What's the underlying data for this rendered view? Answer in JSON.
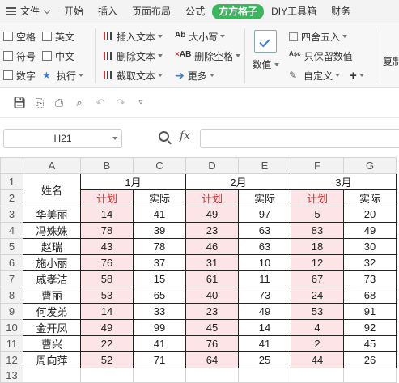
{
  "menu": {
    "file": "文件",
    "tabs": [
      "开始",
      "插入",
      "页面布局",
      "公式",
      "方方格子",
      "DIY工具箱",
      "财务"
    ]
  },
  "ribbon": {
    "checks": [
      "空格",
      "英文",
      "符号",
      "中文",
      "数字"
    ],
    "execute": "执行",
    "text_ops": [
      "插入文本",
      "删除文本",
      "截取文本"
    ],
    "case_ops": [
      "大小写",
      "删除空格",
      "更多"
    ],
    "value_btn": "数值",
    "round_ops": [
      "四舍五入",
      "只保留数值",
      "自定义"
    ],
    "plus": "+",
    "copy_btn": "复制"
  },
  "formula_bar": {
    "cell_ref": "H21",
    "fx": "fx",
    "content": ""
  },
  "sheet": {
    "columns": [
      "A",
      "B",
      "C",
      "D",
      "E",
      "F",
      "G"
    ],
    "rows": [
      "1",
      "2",
      "3",
      "4",
      "5",
      "6",
      "7",
      "8",
      "9",
      "10",
      "11",
      "12",
      "13"
    ],
    "name_header": "姓名",
    "months": [
      "1月",
      "2月",
      "3月"
    ],
    "plan": "计划",
    "actual": "实际",
    "people": [
      {
        "name": "华美丽",
        "v": [
          14,
          41,
          49,
          97,
          5,
          20
        ]
      },
      {
        "name": "冯姝姝",
        "v": [
          78,
          39,
          23,
          63,
          83,
          49
        ]
      },
      {
        "name": "赵瑞",
        "v": [
          43,
          78,
          46,
          63,
          18,
          30
        ]
      },
      {
        "name": "施小丽",
        "v": [
          76,
          37,
          31,
          10,
          12,
          32
        ]
      },
      {
        "name": "戚孝洁",
        "v": [
          58,
          15,
          61,
          11,
          67,
          73
        ]
      },
      {
        "name": "曹丽",
        "v": [
          53,
          65,
          40,
          73,
          24,
          68
        ]
      },
      {
        "name": "何发弟",
        "v": [
          14,
          33,
          23,
          49,
          53,
          91
        ]
      },
      {
        "name": "金开凤",
        "v": [
          49,
          99,
          45,
          14,
          4,
          92
        ]
      },
      {
        "name": "曹兴",
        "v": [
          22,
          41,
          76,
          41,
          2,
          45
        ]
      },
      {
        "name": "周向萍",
        "v": [
          52,
          71,
          64,
          25,
          44,
          26
        ]
      }
    ]
  }
}
